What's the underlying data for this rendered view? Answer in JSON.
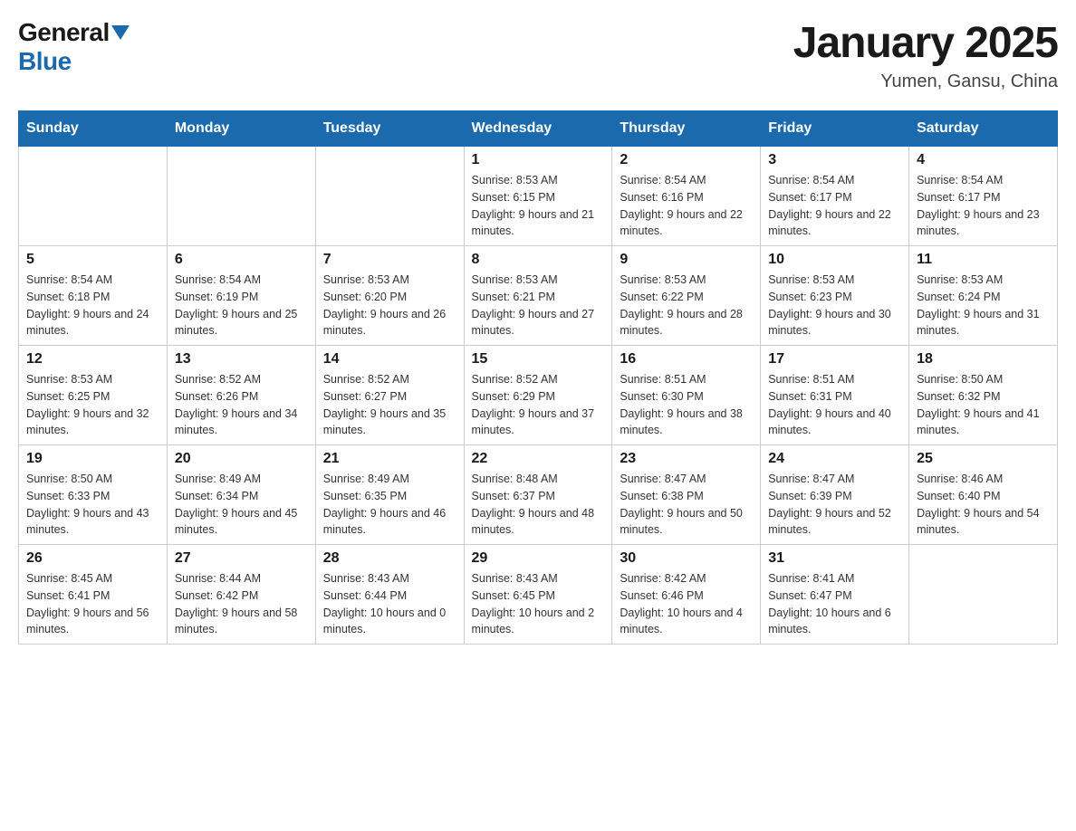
{
  "logo": {
    "general": "General",
    "blue": "Blue"
  },
  "title": "January 2025",
  "subtitle": "Yumen, Gansu, China",
  "days_of_week": [
    "Sunday",
    "Monday",
    "Tuesday",
    "Wednesday",
    "Thursday",
    "Friday",
    "Saturday"
  ],
  "weeks": [
    [
      {
        "day": "",
        "info": ""
      },
      {
        "day": "",
        "info": ""
      },
      {
        "day": "",
        "info": ""
      },
      {
        "day": "1",
        "info": "Sunrise: 8:53 AM\nSunset: 6:15 PM\nDaylight: 9 hours and 21 minutes."
      },
      {
        "day": "2",
        "info": "Sunrise: 8:54 AM\nSunset: 6:16 PM\nDaylight: 9 hours and 22 minutes."
      },
      {
        "day": "3",
        "info": "Sunrise: 8:54 AM\nSunset: 6:17 PM\nDaylight: 9 hours and 22 minutes."
      },
      {
        "day": "4",
        "info": "Sunrise: 8:54 AM\nSunset: 6:17 PM\nDaylight: 9 hours and 23 minutes."
      }
    ],
    [
      {
        "day": "5",
        "info": "Sunrise: 8:54 AM\nSunset: 6:18 PM\nDaylight: 9 hours and 24 minutes."
      },
      {
        "day": "6",
        "info": "Sunrise: 8:54 AM\nSunset: 6:19 PM\nDaylight: 9 hours and 25 minutes."
      },
      {
        "day": "7",
        "info": "Sunrise: 8:53 AM\nSunset: 6:20 PM\nDaylight: 9 hours and 26 minutes."
      },
      {
        "day": "8",
        "info": "Sunrise: 8:53 AM\nSunset: 6:21 PM\nDaylight: 9 hours and 27 minutes."
      },
      {
        "day": "9",
        "info": "Sunrise: 8:53 AM\nSunset: 6:22 PM\nDaylight: 9 hours and 28 minutes."
      },
      {
        "day": "10",
        "info": "Sunrise: 8:53 AM\nSunset: 6:23 PM\nDaylight: 9 hours and 30 minutes."
      },
      {
        "day": "11",
        "info": "Sunrise: 8:53 AM\nSunset: 6:24 PM\nDaylight: 9 hours and 31 minutes."
      }
    ],
    [
      {
        "day": "12",
        "info": "Sunrise: 8:53 AM\nSunset: 6:25 PM\nDaylight: 9 hours and 32 minutes."
      },
      {
        "day": "13",
        "info": "Sunrise: 8:52 AM\nSunset: 6:26 PM\nDaylight: 9 hours and 34 minutes."
      },
      {
        "day": "14",
        "info": "Sunrise: 8:52 AM\nSunset: 6:27 PM\nDaylight: 9 hours and 35 minutes."
      },
      {
        "day": "15",
        "info": "Sunrise: 8:52 AM\nSunset: 6:29 PM\nDaylight: 9 hours and 37 minutes."
      },
      {
        "day": "16",
        "info": "Sunrise: 8:51 AM\nSunset: 6:30 PM\nDaylight: 9 hours and 38 minutes."
      },
      {
        "day": "17",
        "info": "Sunrise: 8:51 AM\nSunset: 6:31 PM\nDaylight: 9 hours and 40 minutes."
      },
      {
        "day": "18",
        "info": "Sunrise: 8:50 AM\nSunset: 6:32 PM\nDaylight: 9 hours and 41 minutes."
      }
    ],
    [
      {
        "day": "19",
        "info": "Sunrise: 8:50 AM\nSunset: 6:33 PM\nDaylight: 9 hours and 43 minutes."
      },
      {
        "day": "20",
        "info": "Sunrise: 8:49 AM\nSunset: 6:34 PM\nDaylight: 9 hours and 45 minutes."
      },
      {
        "day": "21",
        "info": "Sunrise: 8:49 AM\nSunset: 6:35 PM\nDaylight: 9 hours and 46 minutes."
      },
      {
        "day": "22",
        "info": "Sunrise: 8:48 AM\nSunset: 6:37 PM\nDaylight: 9 hours and 48 minutes."
      },
      {
        "day": "23",
        "info": "Sunrise: 8:47 AM\nSunset: 6:38 PM\nDaylight: 9 hours and 50 minutes."
      },
      {
        "day": "24",
        "info": "Sunrise: 8:47 AM\nSunset: 6:39 PM\nDaylight: 9 hours and 52 minutes."
      },
      {
        "day": "25",
        "info": "Sunrise: 8:46 AM\nSunset: 6:40 PM\nDaylight: 9 hours and 54 minutes."
      }
    ],
    [
      {
        "day": "26",
        "info": "Sunrise: 8:45 AM\nSunset: 6:41 PM\nDaylight: 9 hours and 56 minutes."
      },
      {
        "day": "27",
        "info": "Sunrise: 8:44 AM\nSunset: 6:42 PM\nDaylight: 9 hours and 58 minutes."
      },
      {
        "day": "28",
        "info": "Sunrise: 8:43 AM\nSunset: 6:44 PM\nDaylight: 10 hours and 0 minutes."
      },
      {
        "day": "29",
        "info": "Sunrise: 8:43 AM\nSunset: 6:45 PM\nDaylight: 10 hours and 2 minutes."
      },
      {
        "day": "30",
        "info": "Sunrise: 8:42 AM\nSunset: 6:46 PM\nDaylight: 10 hours and 4 minutes."
      },
      {
        "day": "31",
        "info": "Sunrise: 8:41 AM\nSunset: 6:47 PM\nDaylight: 10 hours and 6 minutes."
      },
      {
        "day": "",
        "info": ""
      }
    ]
  ]
}
